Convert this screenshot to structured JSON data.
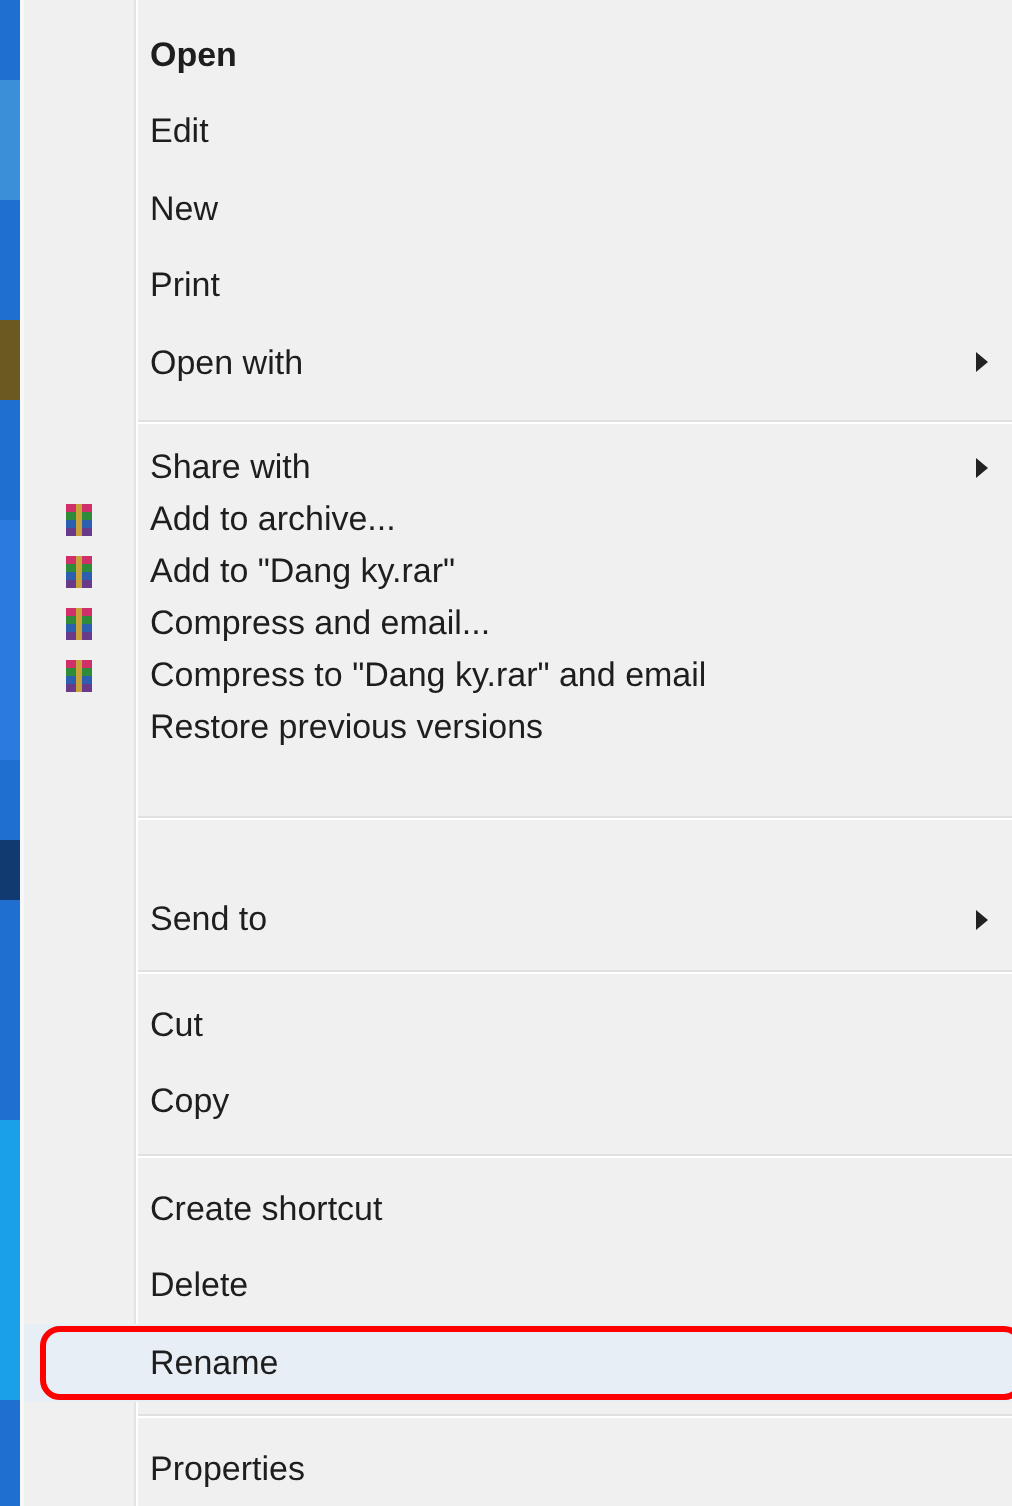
{
  "context_menu": {
    "groups": [
      {
        "items": [
          {
            "kind": "plain",
            "label": "Open",
            "bold": true,
            "submenu": false,
            "highlighted": false
          },
          {
            "kind": "plain",
            "label": "Edit",
            "bold": false,
            "submenu": false,
            "highlighted": false
          },
          {
            "kind": "plain",
            "label": "New",
            "bold": false,
            "submenu": false,
            "highlighted": false
          },
          {
            "kind": "plain",
            "label": "Print",
            "bold": false,
            "submenu": false,
            "highlighted": false
          },
          {
            "kind": "plain",
            "label": "Open with",
            "bold": false,
            "submenu": true,
            "highlighted": false
          }
        ]
      },
      {
        "items": [
          {
            "kind": "plain",
            "label": "Share with",
            "bold": false,
            "submenu": true,
            "highlighted": false
          },
          {
            "kind": "archive",
            "label": "Add to archive...",
            "bold": false,
            "submenu": false,
            "highlighted": false
          },
          {
            "kind": "archive",
            "label": "Add to \"Dang ky.rar\"",
            "bold": false,
            "submenu": false,
            "highlighted": false
          },
          {
            "kind": "archive",
            "label": "Compress and email...",
            "bold": false,
            "submenu": false,
            "highlighted": false
          },
          {
            "kind": "archive",
            "label": "Compress to \"Dang ky.rar\" and email",
            "bold": false,
            "submenu": false,
            "highlighted": false
          },
          {
            "kind": "plain",
            "label": "Restore previous versions",
            "bold": false,
            "submenu": false,
            "highlighted": false
          }
        ]
      },
      {
        "items": [
          {
            "kind": "plain",
            "label": "Send to",
            "bold": false,
            "submenu": true,
            "highlighted": false
          }
        ]
      },
      {
        "items": [
          {
            "kind": "plain",
            "label": "Cut",
            "bold": false,
            "submenu": false,
            "highlighted": false
          },
          {
            "kind": "plain",
            "label": "Copy",
            "bold": false,
            "submenu": false,
            "highlighted": false
          }
        ]
      },
      {
        "items": [
          {
            "kind": "plain",
            "label": "Create shortcut",
            "bold": false,
            "submenu": false,
            "highlighted": false
          },
          {
            "kind": "plain",
            "label": "Delete",
            "bold": false,
            "submenu": false,
            "highlighted": false
          },
          {
            "kind": "plain",
            "label": "Rename",
            "bold": false,
            "submenu": false,
            "highlighted": true
          }
        ]
      },
      {
        "items": [
          {
            "kind": "plain",
            "label": "Properties",
            "bold": false,
            "submenu": false,
            "highlighted": false
          }
        ]
      }
    ]
  }
}
